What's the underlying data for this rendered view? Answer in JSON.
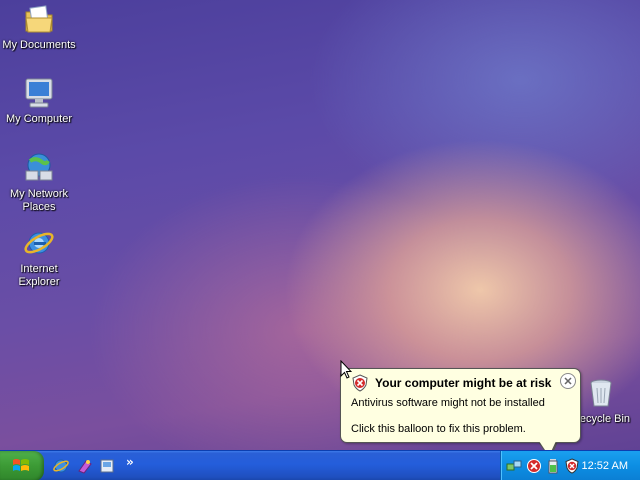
{
  "desktop": {
    "icons": [
      {
        "name": "my-documents",
        "label": "My Documents",
        "icon": "folder-documents-icon"
      },
      {
        "name": "my-computer",
        "label": "My Computer",
        "icon": "computer-icon"
      },
      {
        "name": "my-network-places",
        "label": "My Network Places",
        "icon": "network-icon"
      },
      {
        "name": "internet-explorer",
        "label": "Internet Explorer",
        "icon": "internet-explorer-icon"
      },
      {
        "name": "recycle-bin",
        "label": "Recycle Bin",
        "icon": "recycle-bin-icon"
      }
    ]
  },
  "balloon": {
    "title": "Your computer might be at risk",
    "line1": "Antivirus software might not be installed",
    "line2": "Click this balloon to fix this problem.",
    "icon": "security-shield-red-icon"
  },
  "taskbar": {
    "start_icon": "windows-logo-icon",
    "quick_launch": [
      "internet-explorer-icon",
      "media-player-icon",
      "show-desktop-icon"
    ],
    "chevron": "»",
    "tray_icons": [
      "network-icon",
      "security-alert-icon",
      "battery-icon",
      "security-center-icon"
    ],
    "clock": "12:52 AM"
  }
}
